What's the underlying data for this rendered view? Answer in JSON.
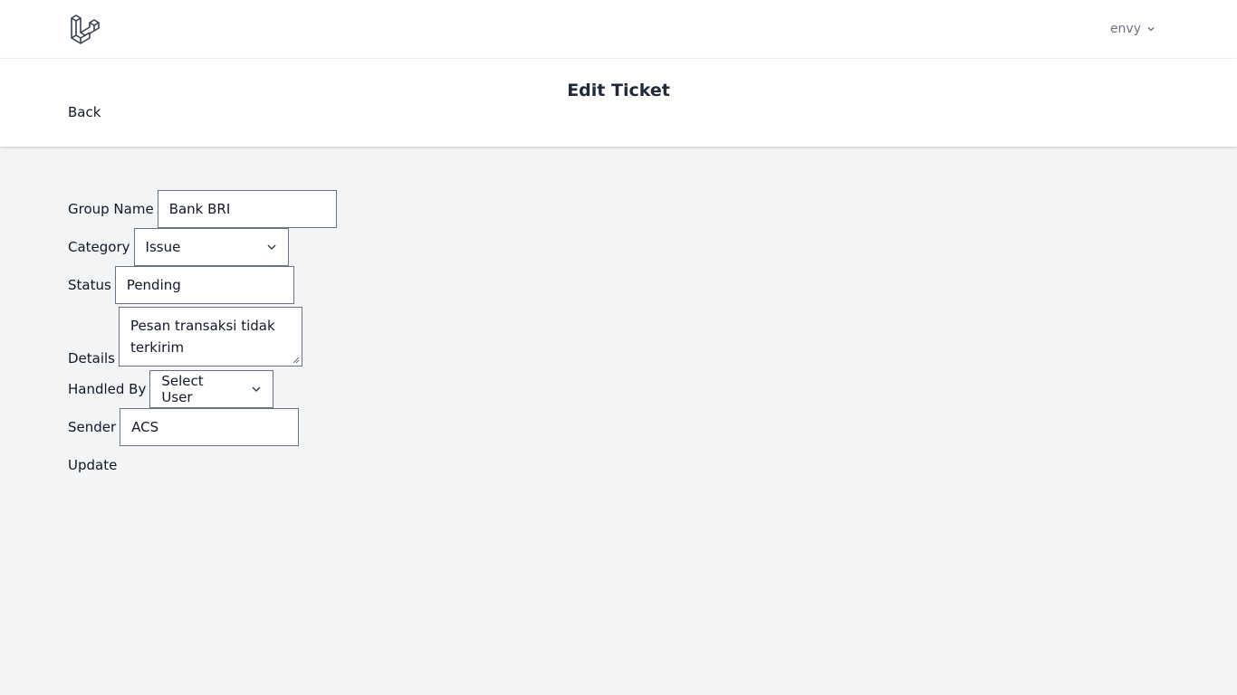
{
  "nav": {
    "logo_icon": "laravel-logo-icon",
    "user_name": "envy"
  },
  "header": {
    "title": "Edit Ticket",
    "back_label": "Back"
  },
  "form": {
    "group_name_label": "Group Name",
    "group_name_value": "Bank BRI",
    "category_label": "Category",
    "category_value": "Issue",
    "status_label": "Status",
    "status_value": "Pending",
    "details_label": "Details",
    "details_value": "Pesan transaksi tidak terkirim",
    "handled_by_label": "Handled By",
    "handled_by_value": "Select User",
    "sender_label": "Sender",
    "sender_value": "ACS",
    "submit_label": "Update"
  }
}
